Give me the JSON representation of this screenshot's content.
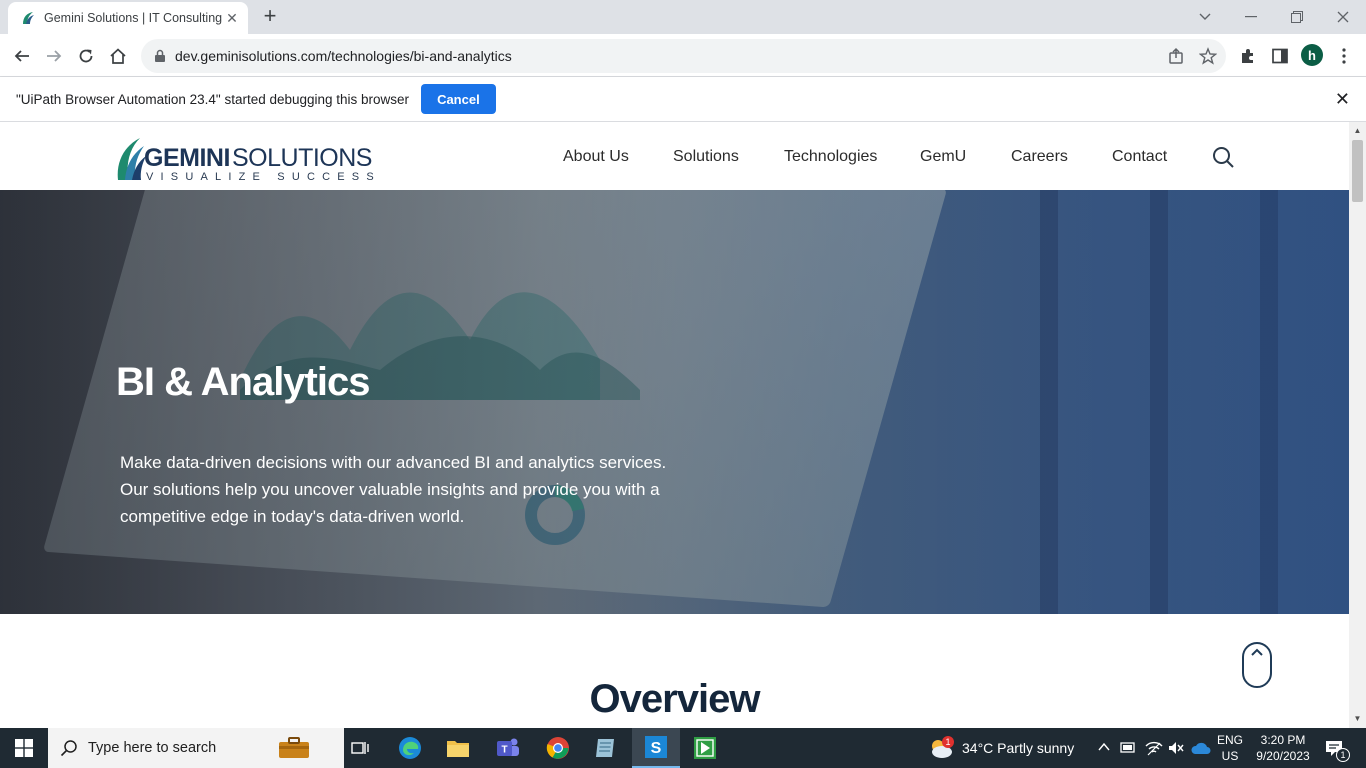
{
  "browser": {
    "tab_title": "Gemini Solutions | IT Consulting",
    "url": "dev.geminisolutions.com/technologies/bi-and-analytics",
    "profile_initial": "h"
  },
  "infobar": {
    "message": "\"UiPath Browser Automation 23.4\" started debugging this browser",
    "cancel_label": "Cancel"
  },
  "site": {
    "logo_name": "GEMINI SOLUTIONS",
    "logo_tagline": "VISUALIZE SUCCESS",
    "nav": [
      "About Us",
      "Solutions",
      "Technologies",
      "GemU",
      "Careers",
      "Contact"
    ]
  },
  "hero": {
    "title": "BI & Analytics",
    "description": "Make data-driven decisions with our advanced BI and analytics services. Our solutions help you uncover valuable insights and provide you with a competitive edge in today's data-driven world."
  },
  "overview": {
    "title": "Overview"
  },
  "taskbar": {
    "search_placeholder": "Type here to search",
    "weather": "34°C  Partly sunny",
    "weather_badge": "1",
    "lang": "ENG",
    "region": "US",
    "time": "3:20 PM",
    "date": "9/20/2023",
    "notification_count": "1"
  },
  "colors": {
    "chrome_accent": "#1a73e8",
    "brand_navy": "#14263b",
    "taskbar_bg": "#1f2a33"
  }
}
